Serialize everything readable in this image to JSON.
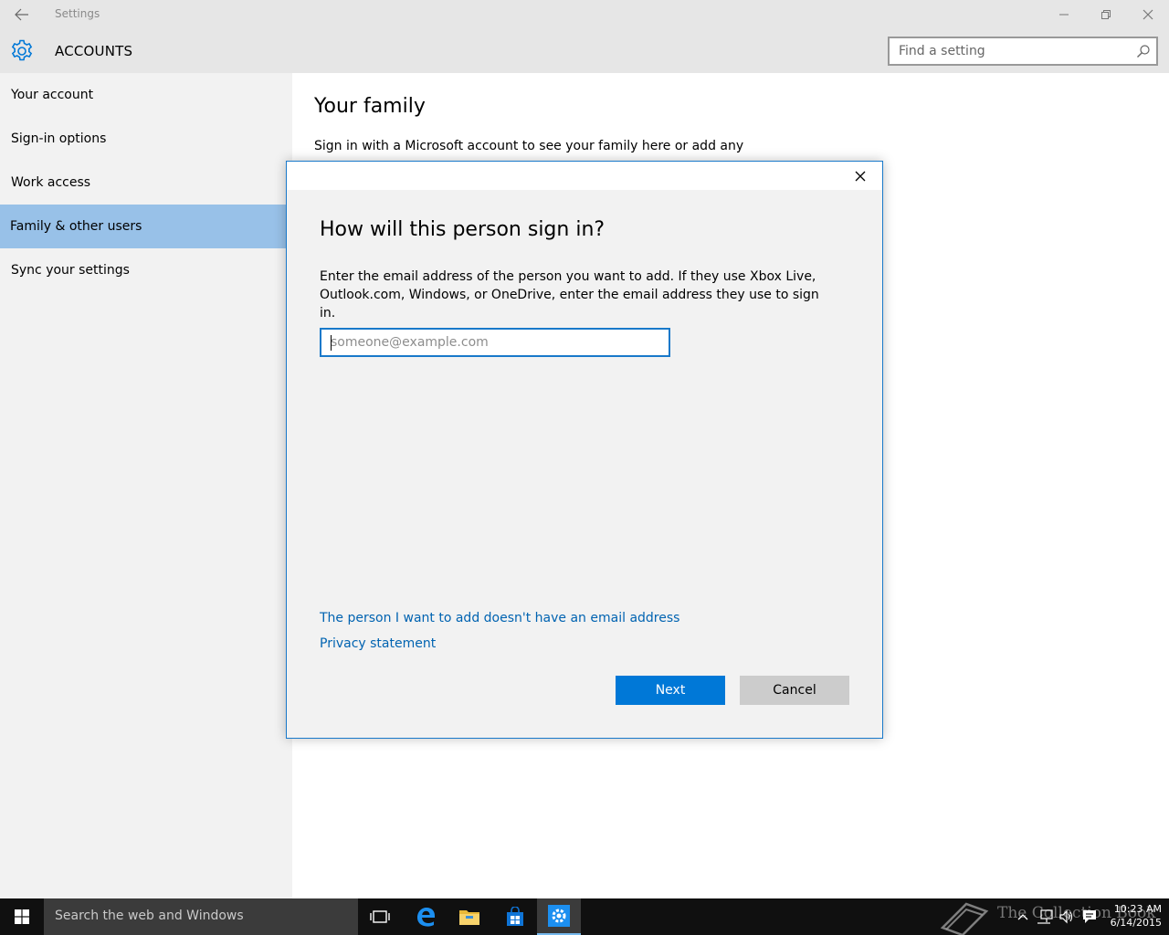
{
  "window": {
    "title": "Settings",
    "controls": [
      "minimize",
      "restore",
      "close"
    ]
  },
  "header": {
    "section": "ACCOUNTS",
    "search_placeholder": "Find a setting"
  },
  "sidebar": {
    "items": [
      {
        "label": "Your account"
      },
      {
        "label": "Sign-in options"
      },
      {
        "label": "Work access"
      },
      {
        "label": "Family & other users",
        "active": true
      },
      {
        "label": "Sync your settings"
      }
    ]
  },
  "main": {
    "heading": "Your family",
    "description": "Sign in with a Microsoft account to see your family here or add any"
  },
  "dialog": {
    "heading": "How will this person sign in?",
    "body_line1": "Enter the email address of the person you want to add. If they use Xbox Live,",
    "body_line2": "Outlook.com, Windows, or OneDrive, enter the email address they use to sign in.",
    "email_placeholder": "someone@example.com",
    "email_value": "",
    "no_email_link": "The person I want to add doesn't have an email address",
    "privacy_link": "Privacy statement",
    "next_label": "Next",
    "cancel_label": "Cancel"
  },
  "taskbar": {
    "search_placeholder": "Search the web and Windows",
    "pinned": [
      "task-view",
      "edge",
      "file-explorer",
      "store",
      "settings"
    ],
    "active_app": "settings",
    "watermark": "The Collection Book",
    "time": "10:23 AM",
    "date": "6/14/2015"
  },
  "colors": {
    "accent": "#0078d7",
    "nav_selected": "#98c1e8",
    "link": "#0063b1"
  }
}
